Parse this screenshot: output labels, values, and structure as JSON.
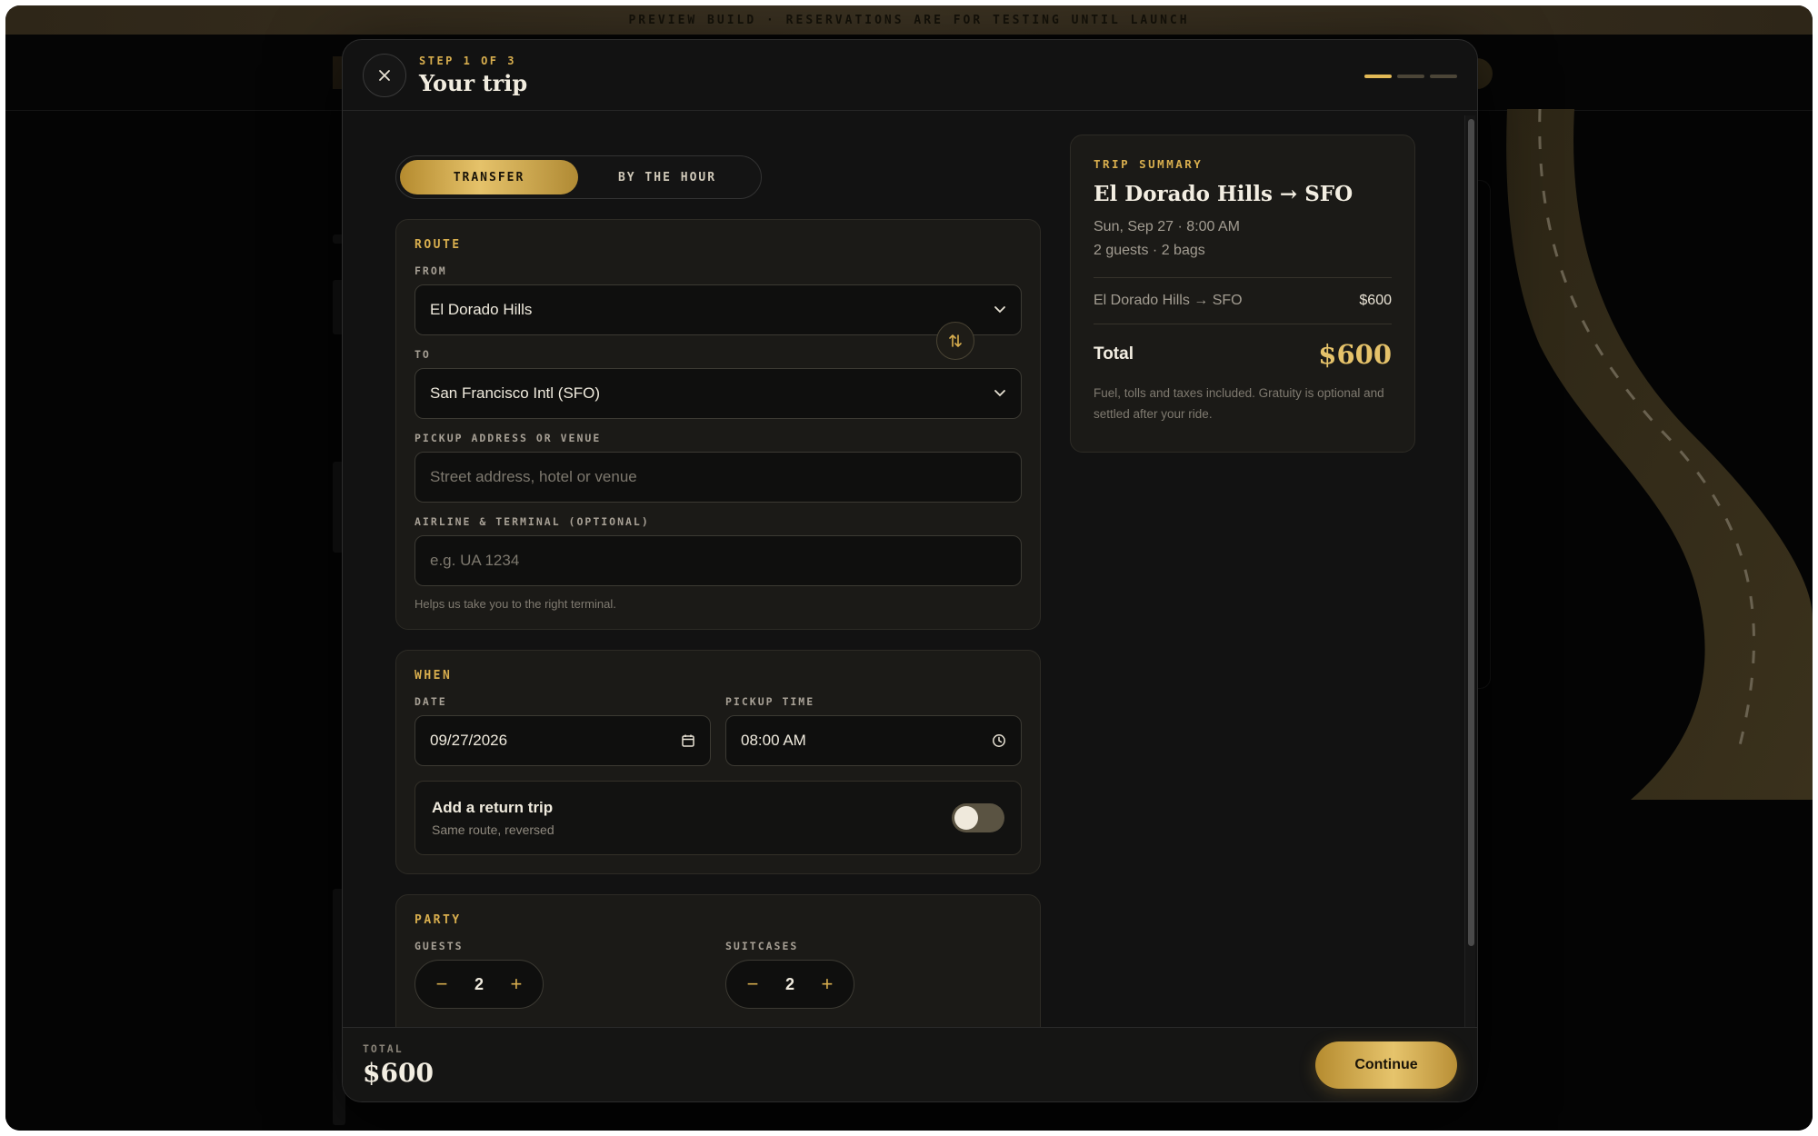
{
  "banner": {
    "text": "PREVIEW BUILD · RESERVATIONS ARE FOR TESTING UNTIL LAUNCH"
  },
  "modal": {
    "step_label": "STEP 1 OF 3",
    "title": "Your trip",
    "progress": {
      "current": 1,
      "total": 3
    }
  },
  "mode_toggle": {
    "options": [
      "TRANSFER",
      "BY THE HOUR"
    ],
    "selected": "TRANSFER"
  },
  "route": {
    "section_title": "ROUTE",
    "from_label": "FROM",
    "from_value": "El Dorado Hills",
    "to_label": "TO",
    "to_value": "San Francisco Intl (SFO)",
    "pickup_label": "PICKUP ADDRESS OR VENUE",
    "pickup_placeholder": "Street address, hotel or venue",
    "airline_label": "AIRLINE & TERMINAL (OPTIONAL)",
    "airline_placeholder": "e.g. UA 1234",
    "airline_helper": "Helps us take you to the right terminal."
  },
  "when": {
    "section_title": "WHEN",
    "date_label": "DATE",
    "date_value": "09/27/2026",
    "time_label": "PICKUP TIME",
    "time_value": "08:00 AM",
    "return_title": "Add a return trip",
    "return_sub": "Same route, reversed",
    "return_enabled": false
  },
  "party": {
    "section_title": "PARTY",
    "guests_label": "GUESTS",
    "guests_value": "2",
    "suitcases_label": "SUITCASES",
    "suitcases_value": "2",
    "minus": "−",
    "plus": "+"
  },
  "summary": {
    "label": "TRIP SUMMARY",
    "route": "El Dorado Hills → SFO",
    "datetime": "Sun, Sep 27 · 8:00 AM",
    "party": "2 guests · 2 bags",
    "line_label": "El Dorado Hills → SFO",
    "line_amount": "$600",
    "total_label": "Total",
    "total_value": "$600",
    "note": "Fuel, tolls and taxes included. Gratuity is optional and settled after your ride."
  },
  "footer": {
    "total_label": "TOTAL",
    "total_value": "$600",
    "continue_label": "Continue"
  },
  "colors": {
    "accent": "#d8ae4e",
    "background": "#121212",
    "card": "#1b1a17"
  }
}
